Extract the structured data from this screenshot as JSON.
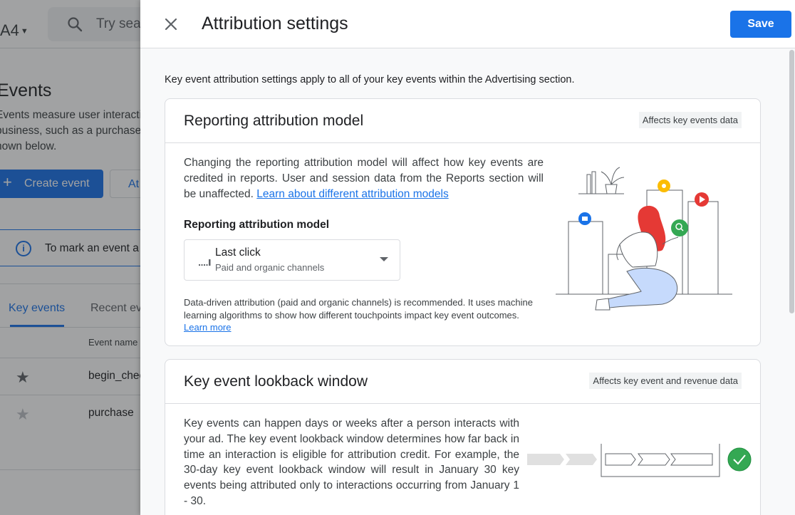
{
  "background": {
    "property_label": "A4",
    "search_placeholder": "Try sea",
    "page_title": "Events",
    "description": "Events measure user interacti business, such as a purchase hown below.",
    "create_button": "Create event",
    "secondary_button": "At",
    "banner_text": "To mark an event a",
    "tabs": [
      {
        "label": "Key events",
        "active": true
      },
      {
        "label": "Recent ev",
        "active": false
      }
    ],
    "column_header": "Event name",
    "rows": [
      {
        "name": "begin_chec",
        "starred": true
      },
      {
        "name": "purchase",
        "starred": false
      }
    ]
  },
  "dialog": {
    "title": "Attribution settings",
    "save_label": "Save",
    "intro": "Key event attribution settings apply to all of your key events within the Advertising section.",
    "reporting": {
      "title": "Reporting attribution model",
      "chip": "Affects key events data",
      "body": "Changing the reporting attribution model will affect how key events are credited in reports. User and session data from the Reports section will be unaffected. ",
      "body_link": "Learn about different attribution models",
      "field_label": "Reporting attribution model",
      "select_value": "Last click",
      "select_subtext": "Paid and organic channels",
      "note": "Data-driven attribution (paid and organic channels) is recommended. It uses machine learning algorithms to show how different touchpoints impact key event outcomes. ",
      "note_link": "Learn more"
    },
    "lookback": {
      "title": "Key event lookback window",
      "chip": "Affects key event and revenue data",
      "body": "Key events can happen days or weeks after a person interacts with your ad. The key event lookback window determines how far back in time an interaction is eligible for attribution credit. For example, the 30-day key event lookback window will result in January 30 key events being attributed only to interactions occurring from January 1 - 30."
    }
  },
  "colors": {
    "primary": "#1a73e8",
    "success": "#34a853",
    "illustration_red": "#e53935",
    "illustration_yellow": "#fbbc04"
  }
}
